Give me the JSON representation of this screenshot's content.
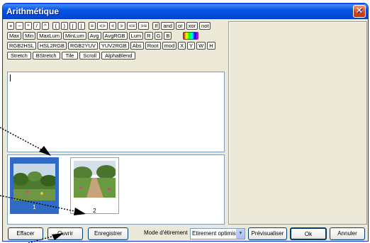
{
  "window": {
    "title": "Arithmétique"
  },
  "toolbar": {
    "row1": [
      "+",
      "−",
      "*",
      "/",
      "^",
      "(",
      ")",
      "|",
      "|",
      "=",
      "<>",
      "<",
      ">",
      "<=",
      ">=",
      "If",
      "and",
      "or",
      "xor",
      "not"
    ],
    "row2": [
      "Max",
      "Min",
      "MaxLum",
      "MinLum",
      "Avg",
      "AvgRGB",
      "Lum",
      "R",
      "G",
      "B"
    ],
    "row3": [
      "RGB2HSL",
      "HSL2RGB",
      "RGB2YUV",
      "YUV2RGB",
      "Abs",
      "Root",
      "mod",
      "X",
      "Y",
      "W",
      "H"
    ],
    "row4": [
      "Stretch",
      "BStretch",
      "Tile",
      "Scroll",
      "AlphaBlend"
    ]
  },
  "thumbnails": [
    {
      "number": "1",
      "selected": true
    },
    {
      "number": "2",
      "selected": false
    }
  ],
  "bottom": {
    "effacer": "Effacer",
    "ouvrir": "Ouvrir",
    "enregistrer": "Enregistrer",
    "mode_label": "Mode d'étirement",
    "mode_value": "Etirement optimisé",
    "previsualiser": "Prévisualiser",
    "ok": "Ok",
    "annuler": "Annuler"
  },
  "colors": {
    "title_blue": "#0054e3",
    "selection": "#316ac5",
    "face": "#ece9d8"
  }
}
